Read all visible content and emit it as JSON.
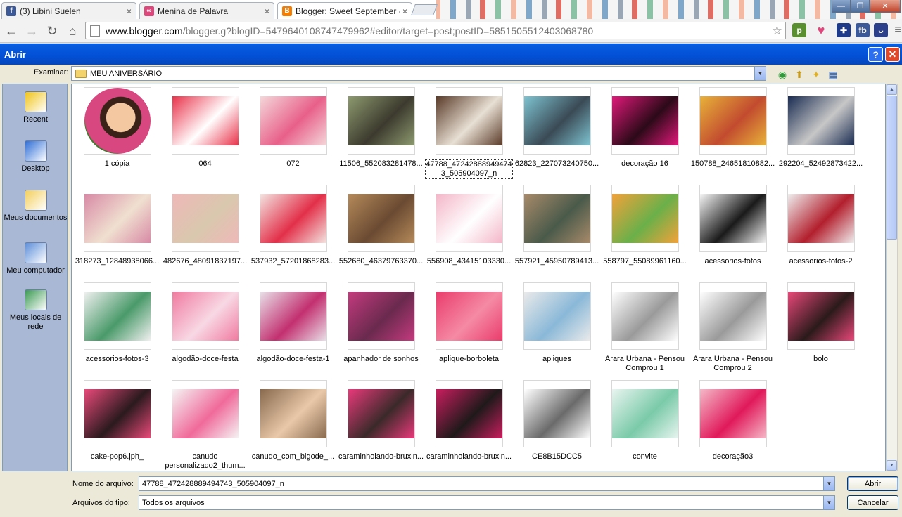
{
  "browser": {
    "tabs": [
      {
        "title": "(3) Libini Suelen",
        "favicon": "facebook-icon",
        "color": "#3b5998",
        "glyph": "f"
      },
      {
        "title": "Menina de Palavra",
        "favicon": "bow-icon",
        "color": "#e0457b",
        "glyph": "∞"
      },
      {
        "title": "Blogger: Sweet September -",
        "favicon": "blogger-icon",
        "color": "#f57d00",
        "glyph": "B"
      }
    ],
    "url_host": "www.blogger.com",
    "url_path": "/blogger.g?blogID=5479640108747479962#editor/target=post;postID=5851505512403068780",
    "extensions": [
      {
        "name": "pinterest-ext-icon",
        "glyph": "p",
        "color": "#5a8f2f"
      },
      {
        "name": "heart-ext-icon",
        "glyph": "♥",
        "color": "#ffffff"
      },
      {
        "name": "flag-ext-icon",
        "glyph": "✚",
        "color": "#1e3a8a"
      },
      {
        "name": "fb-ext-icon",
        "glyph": "fb",
        "color": "#3b5998"
      },
      {
        "name": "hearts-ext-icon",
        "glyph": "ᴗ",
        "color": "#2b3f8a"
      },
      {
        "name": "menu-icon",
        "glyph": "≡",
        "color": "#777777"
      }
    ]
  },
  "dialog": {
    "title": "Abrir",
    "look_in_label": "Examinar:",
    "look_in_value": "MEU ANIVERSÁRIO",
    "places": [
      {
        "label": "Recent",
        "icon": "recent-folder-icon",
        "color": "#f0c419"
      },
      {
        "label": "Desktop",
        "icon": "desktop-icon",
        "color": "#2f6fd6"
      },
      {
        "label": "Meus documentos",
        "icon": "my-documents-icon",
        "color": "#f3cf5a"
      },
      {
        "label": "Meu computador",
        "icon": "my-computer-icon",
        "color": "#5d8fd8"
      },
      {
        "label": "Meus locais de rede",
        "icon": "network-places-icon",
        "color": "#3a9a52"
      }
    ],
    "files": [
      {
        "name": "1 cópia",
        "c1": "#d8477f",
        "c2": "#3f7a2d",
        "shape": "circle"
      },
      {
        "name": "064",
        "c1": "#e8324a",
        "c2": "#ffffff"
      },
      {
        "name": "072",
        "c1": "#f4d7d9",
        "c2": "#e8608a"
      },
      {
        "name": "11506_552083281478...",
        "c1": "#8d9a6f",
        "c2": "#3c3a2e"
      },
      {
        "name": "47788_472428889494743_505904097_n",
        "c1": "#5a3a28",
        "c2": "#e8e0d4",
        "selected": true
      },
      {
        "name": "62823_227073240750...",
        "c1": "#7ec3d1",
        "c2": "#3a4a55"
      },
      {
        "name": "decoração 16",
        "c1": "#e0197a",
        "c2": "#2b0a18"
      },
      {
        "name": "150788_24651810882...",
        "c1": "#e8b23a",
        "c2": "#c24b2f"
      },
      {
        "name": "292204_52492873422...",
        "c1": "#1a2c52",
        "c2": "#c7c7c7"
      },
      {
        "name": "318273_12848938066...",
        "c1": "#d88aa6",
        "c2": "#f0e0d0"
      },
      {
        "name": "482676_48091837197...",
        "c1": "#efb8b8",
        "c2": "#d9c8ae"
      },
      {
        "name": "537932_57201868283...",
        "c1": "#f2e4e0",
        "c2": "#e23049"
      },
      {
        "name": "552680_46379763370...",
        "c1": "#b58a5a",
        "c2": "#6a4a32"
      },
      {
        "name": "556908_43415103330...",
        "c1": "#f4b6c8",
        "c2": "#ffffff"
      },
      {
        "name": "557921_45950789413...",
        "c1": "#a88a6a",
        "c2": "#4a5a4a"
      },
      {
        "name": "558797_55089961160...",
        "c1": "#f2a23a",
        "c2": "#6ab04a"
      },
      {
        "name": "acessorios-fotos",
        "c1": "#f5f5f5",
        "c2": "#1a1a1a"
      },
      {
        "name": "acessorios-fotos-2",
        "c1": "#eeeeee",
        "c2": "#b21f2d"
      },
      {
        "name": "acessorios-fotos-3",
        "c1": "#f0f0f0",
        "c2": "#4a9a6a"
      },
      {
        "name": "algodão-doce-festa",
        "c1": "#f07aa0",
        "c2": "#f8d8e4"
      },
      {
        "name": "algodão-doce-festa-1",
        "c1": "#e8e0e8",
        "c2": "#c23070"
      },
      {
        "name": "apanhador de sonhos",
        "c1": "#c43a7e",
        "c2": "#6a2a4e"
      },
      {
        "name": "aplique-borboleta",
        "c1": "#ea3c6c",
        "c2": "#f58aa4"
      },
      {
        "name": "apliques",
        "c1": "#eaeaea",
        "c2": "#8ab8d8"
      },
      {
        "name": "Arara Urbana - Pensou Comprou 1",
        "c1": "#ffffff",
        "c2": "#9a9a9a",
        "wrap": true
      },
      {
        "name": "Arara Urbana - Pensou Comprou 2",
        "c1": "#ffffff",
        "c2": "#9a9a9a",
        "wrap": true
      },
      {
        "name": "bolo",
        "c1": "#e8487a",
        "c2": "#2a1a1a"
      },
      {
        "name": "cake-pop6.jph_",
        "c1": "#e84a7a",
        "c2": "#2a1a1e"
      },
      {
        "name": "canudo personalizado2_thum...",
        "c1": "#f4f4f4",
        "c2": "#f06a9a",
        "wrap": true
      },
      {
        "name": "canudo_com_bigode_...",
        "c1": "#8a6a4e",
        "c2": "#e8c8a8"
      },
      {
        "name": "caraminholando-bruxin...",
        "c1": "#e83a7a",
        "c2": "#3a2a2a"
      },
      {
        "name": "caraminholando-bruxin...",
        "c1": "#c81e5e",
        "c2": "#1e1a1a"
      },
      {
        "name": "CE8B15DCC5",
        "c1": "#ffffff",
        "c2": "#6a6a6a"
      },
      {
        "name": "convite",
        "c1": "#e8f4f0",
        "c2": "#7acaa8"
      },
      {
        "name": "decoração3",
        "c1": "#f4b8c8",
        "c2": "#e0195a"
      }
    ],
    "filename_label": "Nome do arquivo:",
    "filename_value": "47788_472428889494743_505904097_n",
    "filetype_label": "Arquivos do tipo:",
    "filetype_value": "Todos os arquivos",
    "open_button": "Abrir",
    "cancel_button": "Cancelar"
  }
}
